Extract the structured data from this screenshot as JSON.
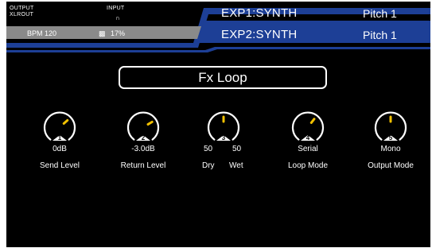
{
  "topbar": {
    "output_label": "OUTPUT",
    "xlrout_label": "XLROUT",
    "input_label": "INPUT",
    "headphones_icon": "headphones-icon",
    "bpm": "BPM 120",
    "tuner_icon": "tuner-icon",
    "cpu": "17%",
    "exp1_label": "EXP1:SYNTH",
    "exp1_value": "Pitch 1",
    "exp2_label": "EXP2:SYNTH",
    "exp2_value": "Pitch 1",
    "accent_color": "#1d3f96",
    "status_gray": "#8a8a8a"
  },
  "main": {
    "title": "Fx Loop",
    "knobs": [
      {
        "index": "1",
        "value": "0dB",
        "label": "Send Level",
        "level": 0.68
      },
      {
        "index": "2",
        "value": "-3.0dB",
        "label": "Return Level",
        "level": 0.72
      },
      {
        "index": "3",
        "value_left": "50",
        "value_right": "50",
        "label_left": "Dry",
        "label_right": "Wet",
        "level": 0.5
      },
      {
        "index": "4",
        "value": "Serial",
        "label": "Loop Mode",
        "level": 0.64
      },
      {
        "index": "5",
        "value": "Mono",
        "label": "Output Mode",
        "level": 0.5
      }
    ],
    "knob_color": "#ffffff",
    "indicator_color": "#f2c100"
  }
}
